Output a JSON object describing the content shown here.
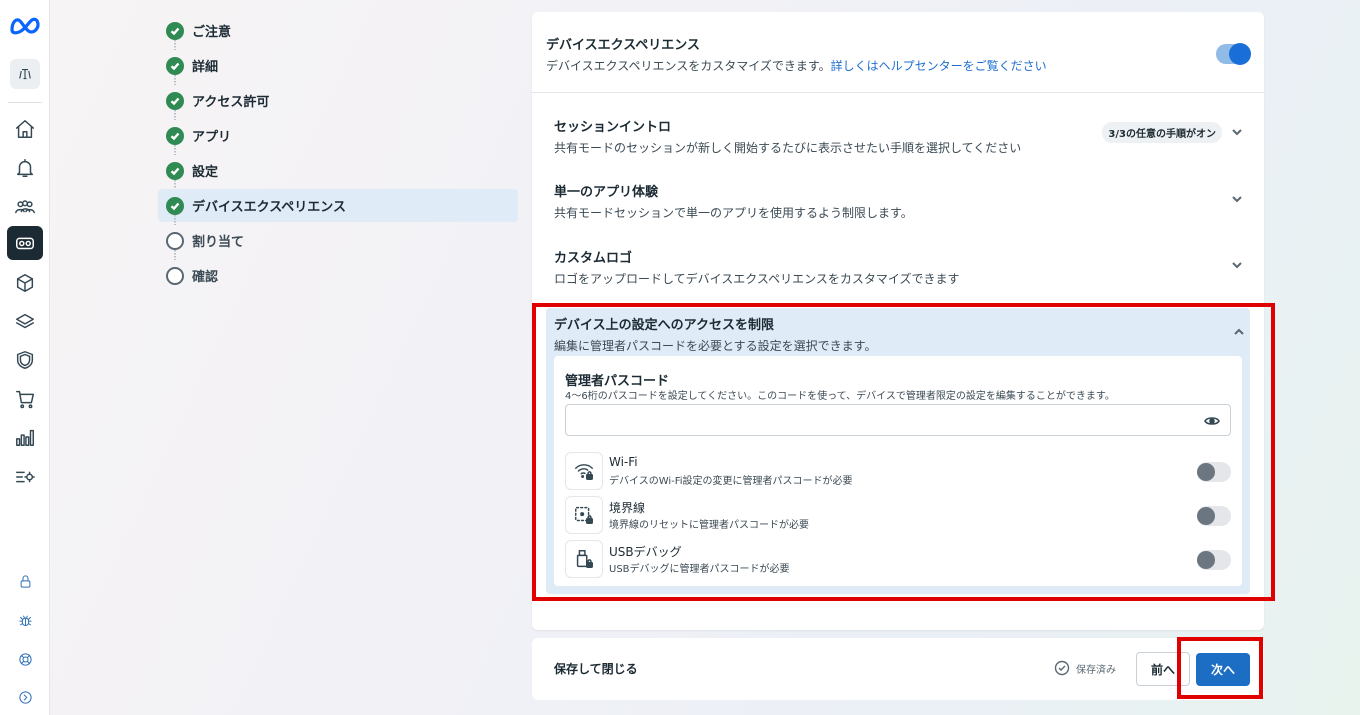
{
  "sidebar": {
    "org_initials": "",
    "items": [
      {
        "name": "home"
      },
      {
        "name": "notifications"
      },
      {
        "name": "people"
      },
      {
        "name": "devices"
      },
      {
        "name": "apps"
      },
      {
        "name": "layers"
      },
      {
        "name": "security"
      },
      {
        "name": "store"
      },
      {
        "name": "analytics"
      },
      {
        "name": "settings"
      }
    ],
    "bottom": [
      {
        "name": "lock"
      },
      {
        "name": "bug"
      },
      {
        "name": "help"
      },
      {
        "name": "expand"
      }
    ]
  },
  "steps": [
    {
      "label": "ご注意",
      "status": "done"
    },
    {
      "label": "詳細",
      "status": "done"
    },
    {
      "label": "アクセス許可",
      "status": "done"
    },
    {
      "label": "アプリ",
      "status": "done"
    },
    {
      "label": "設定",
      "status": "done"
    },
    {
      "label": "デバイスエクスペリエンス",
      "status": "done",
      "active": true
    },
    {
      "label": "割り当て",
      "status": "todo"
    },
    {
      "label": "確認",
      "status": "todo"
    }
  ],
  "device_experience": {
    "title": "デバイスエクスペリエンス",
    "subtitle": "デバイスエクスペリエンスをカスタマイズできます。",
    "help_link": "詳しくはヘルプセンターをご覧ください",
    "enabled": true
  },
  "sections": {
    "session_intro": {
      "title": "セッションイントロ",
      "subtitle": "共有モードのセッションが新しく開始するたびに表示させたい手順を選択してください",
      "badge": "3/3の任意の手順がオン"
    },
    "single_app": {
      "title": "単一のアプリ体験",
      "subtitle": "共有モードセッションで単一のアプリを使用するよう制限します。"
    },
    "custom_logo": {
      "title": "カスタムロゴ",
      "subtitle": "ロゴをアップロードしてデバイスエクスペリエンスをカスタマイズできます"
    },
    "restrict_access": {
      "title": "デバイス上の設定へのアクセスを制限",
      "subtitle": "編集に管理者パスコードを必要とする設定を選択できます。",
      "passcode": {
        "title": "管理者パスコード",
        "subtitle": "4～6桁のパスコードを設定してください。このコードを使って、デバイスで管理者限定の設定を編集することができます。",
        "value": "",
        "placeholder": ""
      },
      "settings": [
        {
          "title": "Wi-Fi",
          "subtitle": "デバイスのWi-Fi設定の変更に管理者パスコードが必要",
          "icon": "wifi-lock-icon",
          "enabled": false
        },
        {
          "title": "境界線",
          "subtitle": "境界線のリセットに管理者パスコードが必要",
          "icon": "boundary-lock-icon",
          "enabled": false
        },
        {
          "title": "USBデバッグ",
          "subtitle": "USBデバッグに管理者パスコードが必要",
          "icon": "usb-lock-icon",
          "enabled": false
        }
      ]
    }
  },
  "footer": {
    "save_close": "保存して閉じる",
    "saved_status": "保存済み",
    "prev": "前へ",
    "next": "次へ"
  },
  "colors": {
    "accent": "#1b6ec4",
    "highlight": "#e00000",
    "success": "#2f8a53"
  }
}
